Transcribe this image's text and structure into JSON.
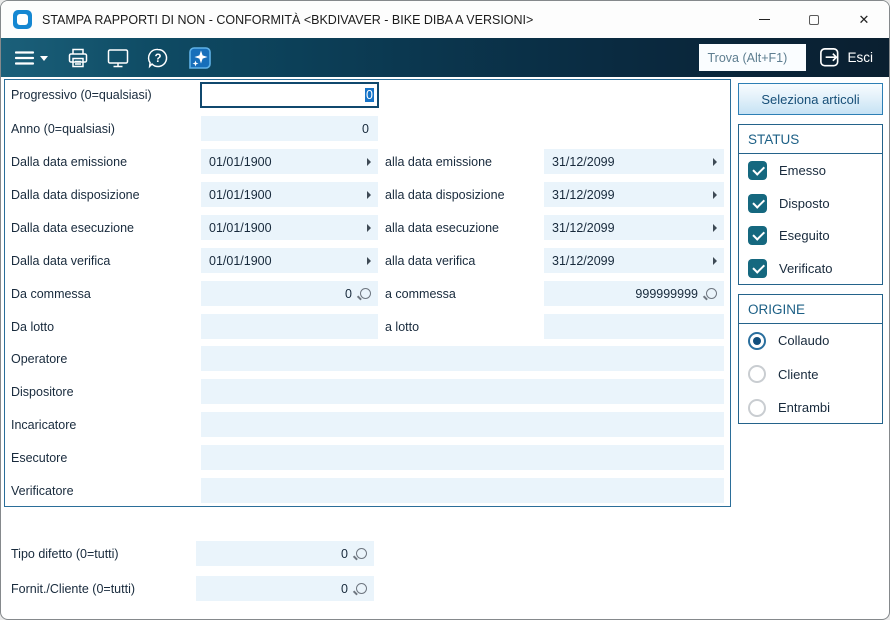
{
  "window": {
    "title": "STAMPA RAPPORTI DI NON - CONFORMITÀ <BKDIVAVER - BIKE DIBA A VERSIONI>"
  },
  "toolbar": {
    "find_placeholder": "Trova (Alt+F1)",
    "exit_label": "Esci",
    "icons": [
      "menu-icon",
      "print-icon",
      "monitor-icon",
      "help-icon",
      "sparkle-badge-icon"
    ]
  },
  "form": {
    "progressivo": {
      "label": "Progressivo (0=qualsiasi)",
      "value": "0"
    },
    "anno": {
      "label": "Anno (0=qualsiasi)",
      "value": "0"
    },
    "date_rows": [
      {
        "from_label": "Dalla data emissione",
        "from_value": "01/01/1900",
        "to_label": "alla data emissione",
        "to_value": "31/12/2099"
      },
      {
        "from_label": "Dalla data disposizione",
        "from_value": "01/01/1900",
        "to_label": "alla data disposizione",
        "to_value": "31/12/2099"
      },
      {
        "from_label": "Dalla data esecuzione",
        "from_value": "01/01/1900",
        "to_label": "alla data esecuzione",
        "to_value": "31/12/2099"
      },
      {
        "from_label": "Dalla data verifica",
        "from_value": "01/01/1900",
        "to_label": "alla data verifica",
        "to_value": "31/12/2099"
      }
    ],
    "commessa": {
      "from_label": "Da commessa",
      "from_value": "0",
      "to_label": "a commessa",
      "to_value": "999999999"
    },
    "lotto": {
      "from_label": "Da lotto",
      "from_value": "",
      "to_label": "a lotto",
      "to_value": ""
    },
    "wide_rows": [
      {
        "label": "Operatore",
        "value": ""
      },
      {
        "label": "Dispositore",
        "value": ""
      },
      {
        "label": "Incaricatore",
        "value": ""
      },
      {
        "label": "Esecutore",
        "value": ""
      },
      {
        "label": "Verificatore",
        "value": ""
      }
    ],
    "tipo_difetto": {
      "label": "Tipo difetto (0=tutti)",
      "value": "0"
    },
    "fornit_cliente": {
      "label": "Fornit./Cliente (0=tutti)",
      "value": "0"
    }
  },
  "right_panel": {
    "select_articles_label": "Seleziona articoli",
    "status": {
      "title": "STATUS",
      "items": [
        {
          "label": "Emesso",
          "checked": true
        },
        {
          "label": "Disposto",
          "checked": true
        },
        {
          "label": "Eseguito",
          "checked": true
        },
        {
          "label": "Verificato",
          "checked": true
        }
      ]
    },
    "origine": {
      "title": "ORIGINE",
      "options": [
        {
          "label": "Collaudo",
          "selected": true
        },
        {
          "label": "Cliente",
          "selected": false
        },
        {
          "label": "Entrambi",
          "selected": false
        }
      ]
    }
  },
  "colors": {
    "toolbar_start": "#1b607a",
    "toolbar_end": "#0a1f30",
    "field_bg": "#eaf4fb",
    "accent_border": "#2b6e99",
    "checkbox": "#15687f",
    "selection": "#1774c8",
    "header_text": "#1d6086"
  }
}
